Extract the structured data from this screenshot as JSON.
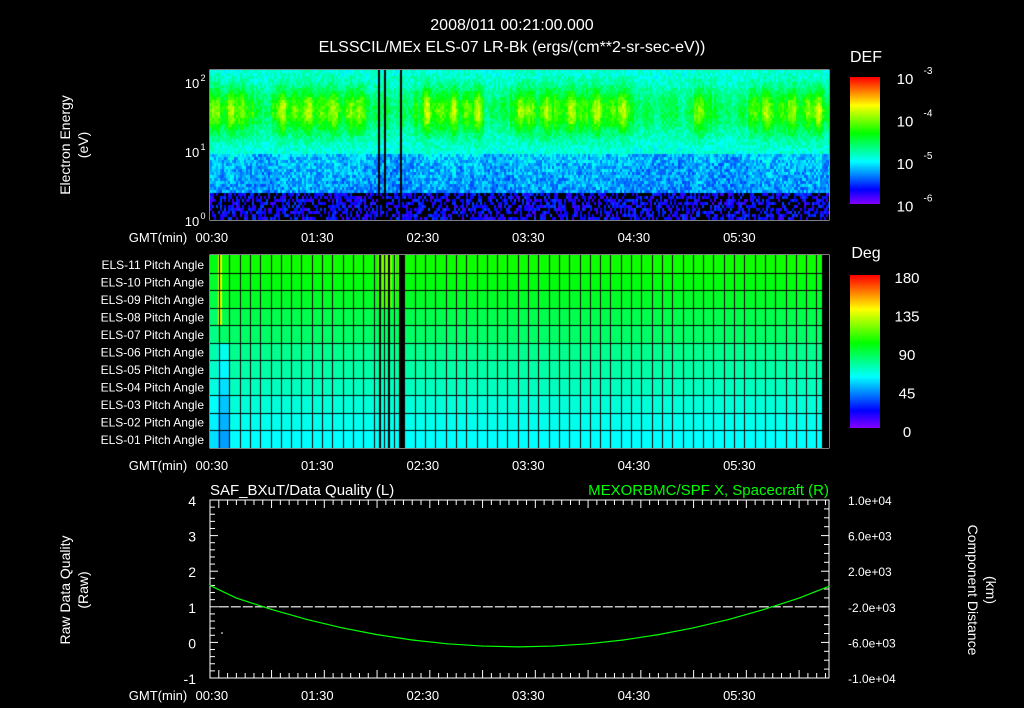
{
  "header": {
    "date_time": "2008/011 00:21:00.000"
  },
  "time_axis": {
    "label": "GMT(min)",
    "range_minutes": [
      25,
      377
    ],
    "ticks": [
      {
        "t": 30,
        "label": "00:30"
      },
      {
        "t": 90,
        "label": "01:30"
      },
      {
        "t": 150,
        "label": "02:30"
      },
      {
        "t": 210,
        "label": "03:30"
      },
      {
        "t": 270,
        "label": "04:30"
      },
      {
        "t": 330,
        "label": "05:30"
      }
    ]
  },
  "chart_data": [
    {
      "type": "heatmap",
      "title": "ELSSCIL/MEx ELS-07 LR-Bk  (ergs/(cm**2-sr-sec-eV))",
      "xlabel": "GMT(min)",
      "ylabel": "Electron Energy",
      "ylabel_units": "(eV)",
      "yscale": "log",
      "ylim": [
        1,
        150
      ],
      "yticks": [
        {
          "v": 1,
          "base": "10",
          "exp": "0"
        },
        {
          "v": 10,
          "base": "10",
          "exp": "1"
        },
        {
          "v": 100,
          "base": "10",
          "exp": "2"
        }
      ],
      "colorbar": {
        "label": "DEF",
        "scale": "log",
        "range": [
          1e-06,
          0.001
        ],
        "ticks": [
          {
            "base": "10",
            "exp": "-3"
          },
          {
            "base": "10",
            "exp": "-4"
          },
          {
            "base": "10",
            "exp": "-5"
          },
          {
            "base": "10",
            "exp": "-6"
          }
        ]
      },
      "active_periods_minutes": [
        [
          25,
          50
        ],
        [
          60,
          115
        ],
        [
          140,
          180
        ],
        [
          195,
          265
        ],
        [
          300,
          310
        ],
        [
          330,
          377
        ]
      ],
      "data_gaps_minutes": [
        [
          120,
          121
        ],
        [
          123,
          124
        ],
        [
          132,
          134
        ]
      ]
    },
    {
      "type": "heatmap",
      "title": "",
      "xlabel": "GMT(min)",
      "rows": [
        {
          "label": "ELS-11 Pitch Angle",
          "deg": 102
        },
        {
          "label": "ELS-10 Pitch Angle",
          "deg": 98
        },
        {
          "label": "ELS-09 Pitch Angle",
          "deg": 94
        },
        {
          "label": "ELS-08 Pitch Angle",
          "deg": 88
        },
        {
          "label": "ELS-07 Pitch Angle",
          "deg": 84
        },
        {
          "label": "ELS-06 Pitch Angle",
          "deg": 78
        },
        {
          "label": "ELS-05 Pitch Angle",
          "deg": 74
        },
        {
          "label": "ELS-04 Pitch Angle",
          "deg": 70
        },
        {
          "label": "ELS-03 Pitch Angle",
          "deg": 66
        },
        {
          "label": "ELS-02 Pitch Angle",
          "deg": 63
        },
        {
          "label": "ELS-01 Pitch Angle",
          "deg": 60
        }
      ],
      "colorbar": {
        "label": "Deg",
        "range": [
          0,
          180
        ],
        "ticks": [
          "180",
          "135",
          "90",
          "45",
          "0"
        ]
      },
      "data_gaps_minutes": [
        [
          121,
          122
        ],
        [
          126,
          127
        ],
        [
          132,
          135
        ],
        [
          373,
          377
        ]
      ]
    },
    {
      "type": "line",
      "title_left": "SAF_BXuT/Data Quality (L)",
      "title_right": "MEXORBMC/SPF X, Spacecraft (R)",
      "xlabel": "GMT(min)",
      "ylabel_left": "Raw Data Quality",
      "ylabel_left_units": "(Raw)",
      "ylabel_right": "Component Distance",
      "ylabel_right_units": "(km)",
      "ylim_left": [
        -1,
        4
      ],
      "yticks_left": [
        "4",
        "3",
        "2",
        "1",
        "0",
        "-1"
      ],
      "ylim_right": [
        -10000,
        10000
      ],
      "yticks_right": [
        "1.0e+04",
        "6.0e+03",
        "2.0e+03",
        "-2.0e+03",
        "-6.0e+03",
        "-1.0e+04"
      ],
      "series": [
        {
          "name": "Data Quality",
          "axis": "left",
          "color": "#ffffff",
          "style": "dashed",
          "x": [
            30,
            375
          ],
          "y": [
            1,
            1
          ]
        },
        {
          "name": "SPF X, Spacecraft",
          "axis": "right",
          "color": "#00ff00",
          "style": "solid",
          "x": [
            25,
            40,
            60,
            80,
            100,
            120,
            140,
            160,
            180,
            200,
            220,
            240,
            260,
            280,
            300,
            320,
            340,
            360,
            377
          ],
          "y": [
            400,
            -1016,
            -2302,
            -3416,
            -4358,
            -5129,
            -5729,
            -6157,
            -6414,
            -6500,
            -6414,
            -6157,
            -5729,
            -5129,
            -4358,
            -3416,
            -2302,
            -1016,
            300
          ]
        }
      ]
    }
  ]
}
